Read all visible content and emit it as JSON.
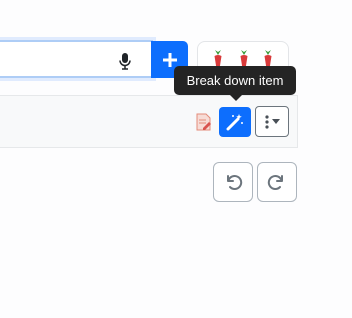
{
  "tooltip": {
    "text": "Break down item"
  },
  "icons": {
    "mic": "microphone-icon",
    "add": "plus-icon",
    "emoji": "carrot-emoji",
    "doc": "document-edit-icon",
    "magic": "magic-wand-icon",
    "more": "vertical-dots-dropdown-icon",
    "undo": "undo-icon",
    "redo": "redo-icon"
  },
  "colors": {
    "primary": "#0d6efd",
    "tooltip_bg": "#242424",
    "input_focus_border": "#aecdf6",
    "toolbar_bg": "#f8f9fa"
  }
}
